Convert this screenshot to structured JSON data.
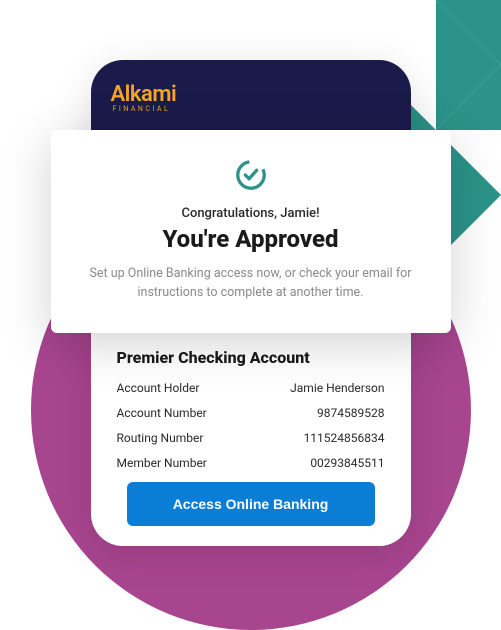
{
  "colors": {
    "teal": "#2b9389",
    "purple": "#a8458f",
    "navy": "#1a1b4b",
    "gold": "#f5a623",
    "cta": "#0a7dd6"
  },
  "logo": {
    "main": "Alkami",
    "sub": "FINANCIAL"
  },
  "modal": {
    "congrats": "Congratulations, Jamie!",
    "headline": "You're Approved",
    "subtext": "Set up Online Banking access now, or check your email for instructions to complete at another time."
  },
  "account": {
    "title": "Premier Checking Account",
    "rows": [
      {
        "label": "Account Holder",
        "value": "Jamie Henderson"
      },
      {
        "label": "Account Number",
        "value": "9874589528"
      },
      {
        "label": "Routing Number",
        "value": "111524856834"
      },
      {
        "label": "Member Number",
        "value": "00293845511"
      }
    ]
  },
  "cta": {
    "label": "Access Online Banking"
  }
}
